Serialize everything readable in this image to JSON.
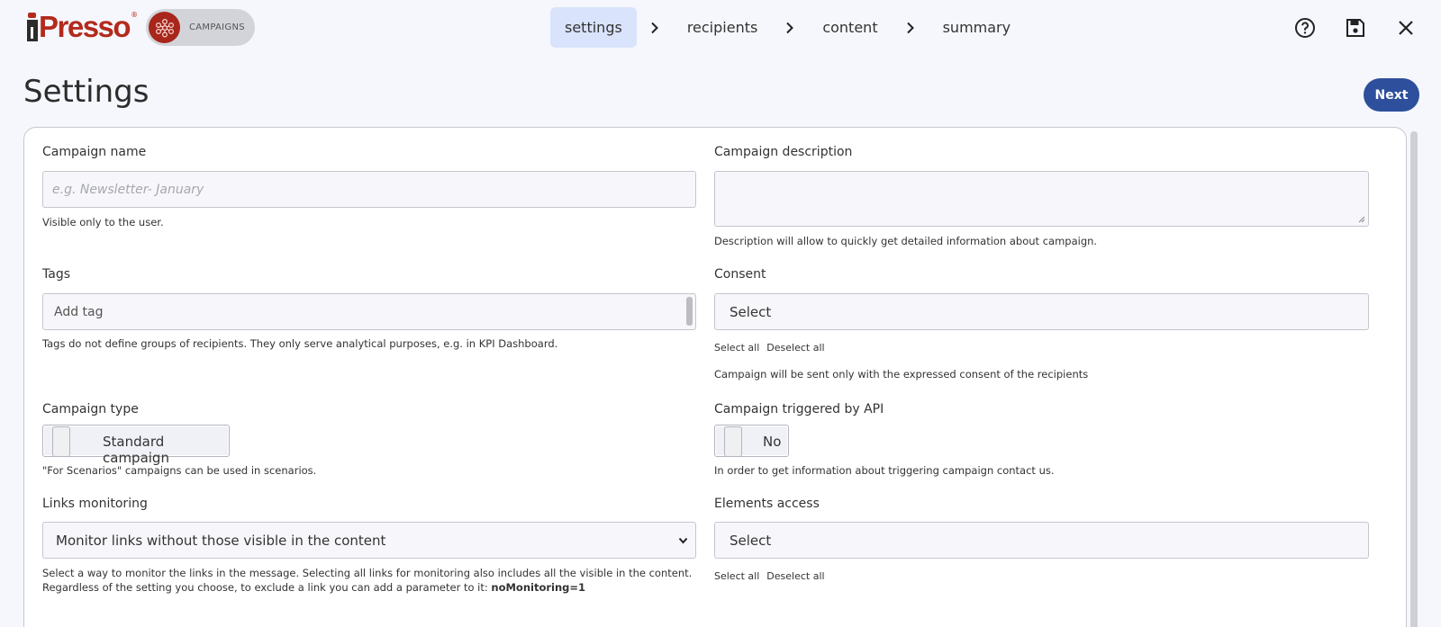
{
  "app": {
    "logo_text": "Presso",
    "logo_reg": "®",
    "module_label": "CAMPAIGNS"
  },
  "stepper": {
    "steps": [
      "settings",
      "recipients",
      "content",
      "summary"
    ],
    "active": "settings"
  },
  "header": {
    "title": "Settings",
    "next_label": "Next"
  },
  "icons": {
    "help": "help-circle-icon",
    "save": "save-disk-icon",
    "close": "close-icon",
    "module": "campaigns-network-icon",
    "step_separator": "chevron-right-icon"
  },
  "colors": {
    "brand_red": "#b32a1d",
    "primary_blue": "#2d4f9c",
    "active_step_bg": "#d9e3fb"
  },
  "form": {
    "campaign_name": {
      "label": "Campaign name",
      "value": "",
      "placeholder": "e.g. Newsletter- January",
      "help": "Visible only to the user."
    },
    "campaign_description": {
      "label": "Campaign description",
      "value": "",
      "help": "Description will allow to quickly get detailed information about campaign."
    },
    "tags": {
      "label": "Tags",
      "value": "",
      "placeholder": "Add tag",
      "help": "Tags do not define groups of recipients. They only serve analytical purposes, e.g. in KPI Dashboard."
    },
    "consent": {
      "label": "Consent",
      "value": "Select",
      "select_all": "Select all",
      "deselect_all": "Deselect all",
      "help": "Campaign will be sent only with the expressed consent of the recipients"
    },
    "campaign_type": {
      "label": "Campaign type",
      "value": "Standard campaign",
      "help": "\"For Scenarios\" campaigns can be used in scenarios."
    },
    "triggered_by_api": {
      "label": "Campaign triggered by API",
      "value": "No",
      "help": "In order to get information about triggering campaign contact us."
    },
    "links_monitoring": {
      "label": "Links monitoring",
      "value": "Monitor links without those visible in the content",
      "help_line1": "Select a way to monitor the links in the message. Selecting all links for monitoring also includes all the visible in the content.",
      "help_line2": "Regardless of the setting you choose, to exclude a link you can add a parameter to it:",
      "help_code": "noMonitoring=1"
    },
    "elements_access": {
      "label": "Elements access",
      "value": "Select",
      "select_all": "Select all",
      "deselect_all": "Deselect all"
    }
  }
}
